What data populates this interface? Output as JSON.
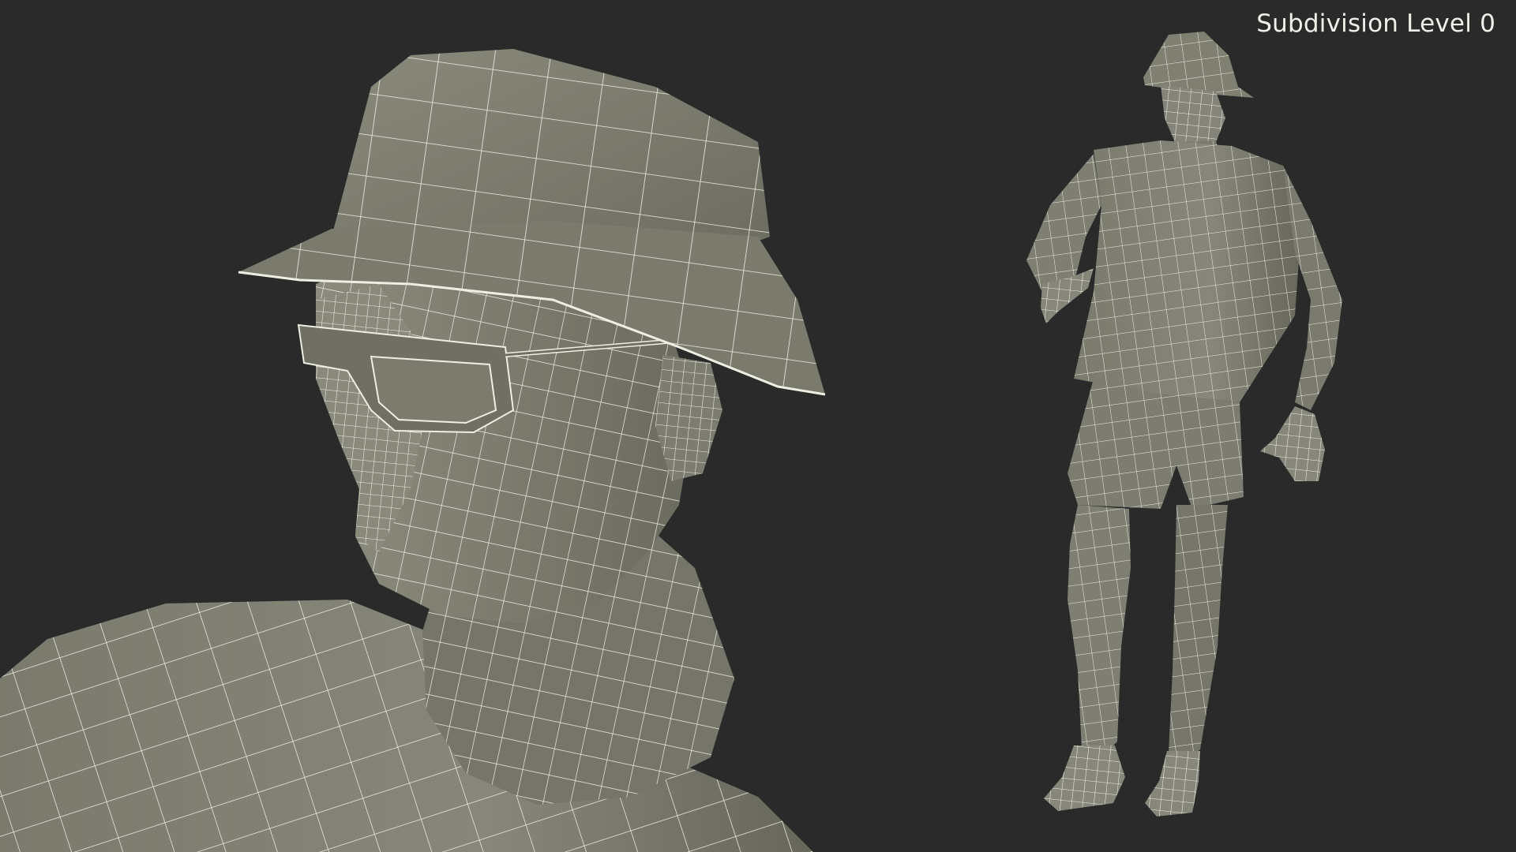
{
  "viewport": {
    "subdivision_label": "Subdivision Level 0"
  },
  "colors": {
    "background": "#2a2a2a",
    "mesh_fill": "#808072",
    "mesh_shadow": "#5e5e54",
    "wire": "#eeeee2",
    "label_text": "#f0f0ea"
  },
  "scene": {
    "close_up": "bust-closeup",
    "full_body": "full-body-figure"
  }
}
